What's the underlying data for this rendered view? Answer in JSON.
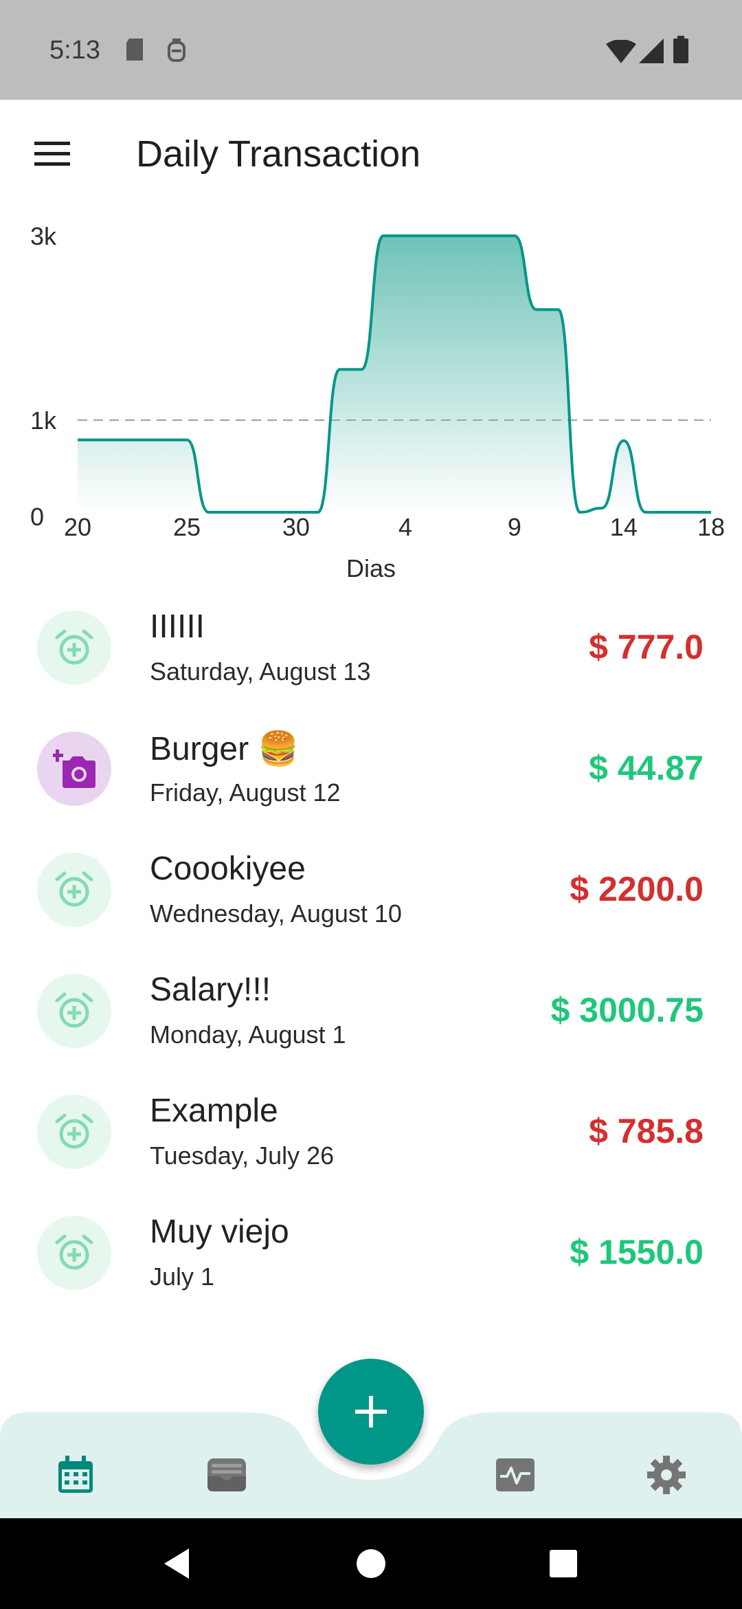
{
  "status_bar": {
    "time": "5:13"
  },
  "app_bar": {
    "title": "Daily Transaction"
  },
  "chart_data": {
    "type": "area",
    "title": "",
    "xlabel": "Dias",
    "ylabel": "",
    "ylim": [
      0,
      3000
    ],
    "y_ticks": [
      {
        "label": "0",
        "value": 0
      },
      {
        "label": "1k",
        "value": 1000
      },
      {
        "label": "3k",
        "value": 3000
      }
    ],
    "x_tick_labels": [
      "20",
      "25",
      "30",
      "4",
      "9",
      "14",
      "18"
    ],
    "x_tick_day_index": [
      0,
      5,
      10,
      15,
      20,
      25,
      29
    ],
    "reference_line": 1000,
    "series": [
      {
        "values": [
          785.8,
          785.8,
          785.8,
          785.8,
          785.8,
          785.8,
          0,
          0,
          0,
          0,
          0,
          0,
          1550,
          1550,
          3000.75,
          3000.75,
          3000.75,
          3000.75,
          3000.75,
          3000.75,
          3000.75,
          2200,
          2200,
          0,
          44.87,
          777,
          0,
          0,
          0,
          0
        ]
      }
    ],
    "grid": false,
    "colors": {
      "line": "#009688",
      "fill_top": "#6fc3b8",
      "fill_bottom": "#ffffff",
      "reference": "#90a4ae"
    }
  },
  "transactions": [
    {
      "title": "IIIIII",
      "date": "Saturday, August 13",
      "amount": "$ 777.0",
      "type": "expense",
      "icon": "alarm-add-icon"
    },
    {
      "title": "Burger 🍔",
      "date": "Friday, August 12",
      "amount": "$ 44.87",
      "type": "income",
      "icon": "add-a-photo-icon"
    },
    {
      "title": "Coookiyee",
      "date": "Wednesday, August 10",
      "amount": "$ 2200.0",
      "type": "expense",
      "icon": "alarm-add-icon"
    },
    {
      "title": "Salary!!!",
      "date": "Monday, August 1",
      "amount": "$ 3000.75",
      "type": "income",
      "icon": "alarm-add-icon"
    },
    {
      "title": "Example",
      "date": "Tuesday, July 26",
      "amount": "$ 785.8",
      "type": "expense",
      "icon": "alarm-add-icon"
    },
    {
      "title": "Muy viejo",
      "date": "July 1",
      "amount": "$ 1550.0",
      "type": "income",
      "icon": "alarm-add-icon"
    }
  ],
  "bottom_nav": {
    "items": [
      {
        "icon": "calendar-icon",
        "active": true
      },
      {
        "icon": "wallet-icon",
        "active": false
      },
      {
        "icon": "activity-icon",
        "active": false
      },
      {
        "icon": "settings-icon",
        "active": false
      }
    ],
    "fab_icon": "plus-icon"
  },
  "colors": {
    "accent": "#009688",
    "income": "#1ec77a",
    "expense": "#d32f2f",
    "nav_background": "#dff1ef",
    "nav_inactive": "#757575"
  }
}
